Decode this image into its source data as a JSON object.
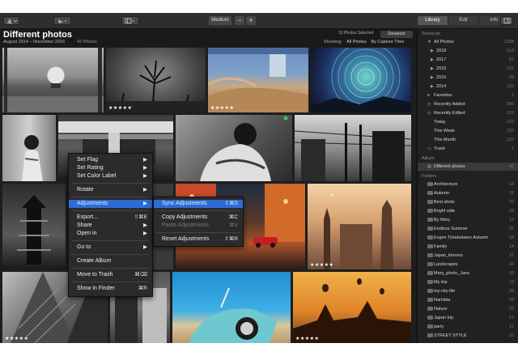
{
  "toolbar": {
    "size_label": "Medium",
    "minus": "−",
    "plus": "+",
    "tabs": [
      {
        "label": "Library",
        "active": true
      },
      {
        "label": "Edit",
        "active": false
      },
      {
        "label": "Info",
        "active": false
      }
    ]
  },
  "gallery": {
    "title": "Different photos",
    "date_range": "August 2014 – November 2016",
    "photo_count": "42 Photos",
    "selection_info": "10 Photos Selected",
    "deselect_label": "Deselect",
    "showing_label": "Showing:",
    "showing_value": "All Photos",
    "sort_value": "By Capture Time"
  },
  "photos": [
    {
      "stars": ""
    },
    {
      "stars": "★★★★★"
    },
    {
      "stars": "★★★★★"
    },
    {
      "stars": ""
    },
    {
      "stars": ""
    },
    {
      "stars": ""
    },
    {
      "stars": ""
    },
    {
      "stars": ""
    },
    {
      "stars": ""
    },
    {
      "stars": ""
    },
    {
      "stars": "★★★★★"
    },
    {
      "stars": "★★★★★"
    },
    {
      "stars": ""
    },
    {
      "stars": ""
    },
    {
      "stars": "★★★★★"
    }
  ],
  "context_menu": {
    "items": [
      {
        "label": "Set Flag",
        "shortcut": "▶"
      },
      {
        "label": "Set Rating",
        "shortcut": "▶"
      },
      {
        "label": "Set Color Label",
        "shortcut": "▶"
      },
      {
        "label": "Rotate",
        "shortcut": "▶"
      },
      {
        "label": "Adjustments",
        "shortcut": "▶"
      },
      {
        "label": "Export...",
        "shortcut": "⇧⌘E"
      },
      {
        "label": "Share",
        "shortcut": "▶"
      },
      {
        "label": "Open in",
        "shortcut": "▶"
      },
      {
        "label": "Go to",
        "shortcut": "▶"
      },
      {
        "label": "Create Album",
        "shortcut": ""
      },
      {
        "label": "Move to Trash",
        "shortcut": "⌘⌫"
      },
      {
        "label": "Show in Finder",
        "shortcut": "⌘R"
      }
    ],
    "submenu": [
      {
        "label": "Sync Adjustments",
        "shortcut": "⇧⌘S"
      },
      {
        "label": "Copy Adjustments",
        "shortcut": "⌘C"
      },
      {
        "label": "Paste Adjustments",
        "shortcut": "⌘V"
      },
      {
        "label": "Reset Adjustments",
        "shortcut": "⇧⌘R"
      }
    ]
  },
  "sidebar": {
    "shortcuts_header": "Shortcuts",
    "shortcuts": [
      {
        "label": "All Photos",
        "count": "1258"
      },
      {
        "label": "2018",
        "count": "513"
      },
      {
        "label": "2017",
        "count": "51"
      },
      {
        "label": "2016",
        "count": "131"
      },
      {
        "label": "2015",
        "count": "93"
      },
      {
        "label": "2014",
        "count": "122"
      },
      {
        "label": "Favorites",
        "count": "1"
      },
      {
        "label": "Recently Added",
        "count": "586"
      },
      {
        "label": "Recently Edited",
        "count": "122"
      },
      {
        "label": "Today",
        "count": "122"
      },
      {
        "label": "This Week",
        "count": "122"
      },
      {
        "label": "This Month",
        "count": "122"
      },
      {
        "label": "Trash",
        "count": "1"
      }
    ],
    "albums_header": "Album",
    "albums": [
      {
        "label": "Different photos",
        "count": "42"
      }
    ],
    "folders_header": "Folders",
    "folders": [
      {
        "label": "Architecture",
        "count": "13"
      },
      {
        "label": "Autumn",
        "count": "11"
      },
      {
        "label": "Best shots",
        "count": "22"
      },
      {
        "label": "Bright side",
        "count": "16"
      },
      {
        "label": "By Mary",
        "count": "12"
      },
      {
        "label": "Endless Summer",
        "count": "31"
      },
      {
        "label": "Evgen Tchebotarev Autumn",
        "count": "18"
      },
      {
        "label": "Family",
        "count": "14"
      },
      {
        "label": "Japan_kimono",
        "count": "27"
      },
      {
        "label": "Landscapes",
        "count": "42"
      },
      {
        "label": "Mary_photo_Jane",
        "count": "10"
      },
      {
        "label": "My trip",
        "count": "19"
      },
      {
        "label": "my-city-life",
        "count": "34"
      },
      {
        "label": "Namibia",
        "count": "15"
      },
      {
        "label": "Nature",
        "count": "23"
      },
      {
        "label": "Japan trip",
        "count": "17"
      },
      {
        "label": "party",
        "count": "12"
      },
      {
        "label": "STREET STYLE",
        "count": "22"
      },
      {
        "label": "Streets",
        "count": "28"
      }
    ]
  }
}
